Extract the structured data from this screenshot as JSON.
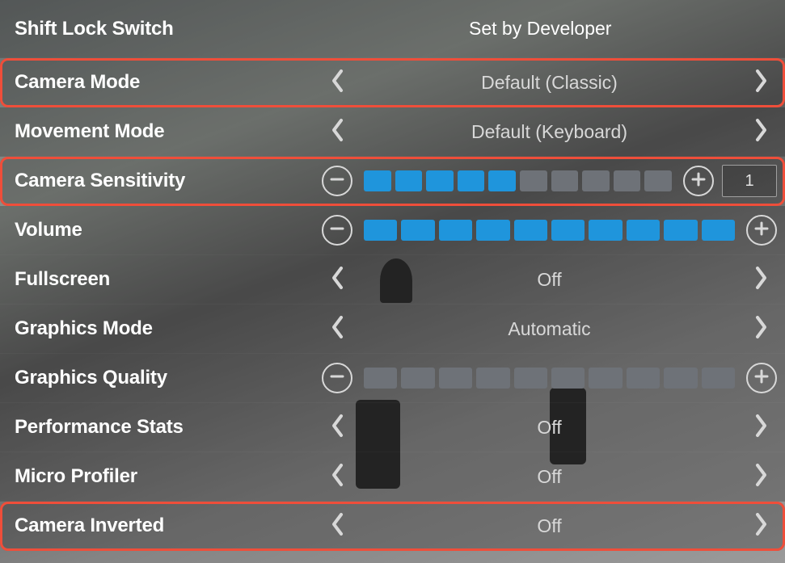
{
  "settings": {
    "shift_lock": {
      "label": "Shift Lock Switch",
      "value": "Set by Developer"
    },
    "camera_mode": {
      "label": "Camera Mode",
      "value": "Default (Classic)"
    },
    "movement": {
      "label": "Movement Mode",
      "value": "Default (Keyboard)"
    },
    "cam_sens": {
      "label": "Camera Sensitivity",
      "level": 5,
      "max": 10,
      "input": "1"
    },
    "volume": {
      "label": "Volume",
      "level": 10,
      "max": 10
    },
    "fullscreen": {
      "label": "Fullscreen",
      "value": "Off"
    },
    "gfx_mode": {
      "label": "Graphics Mode",
      "value": "Automatic"
    },
    "gfx_quality": {
      "label": "Graphics Quality",
      "level": 0,
      "max": 10
    },
    "perf_stats": {
      "label": "Performance Stats",
      "value": "Off"
    },
    "micro_prof": {
      "label": "Micro Profiler",
      "value": "Off"
    },
    "cam_inverted": {
      "label": "Camera Inverted",
      "value": "Off"
    }
  }
}
